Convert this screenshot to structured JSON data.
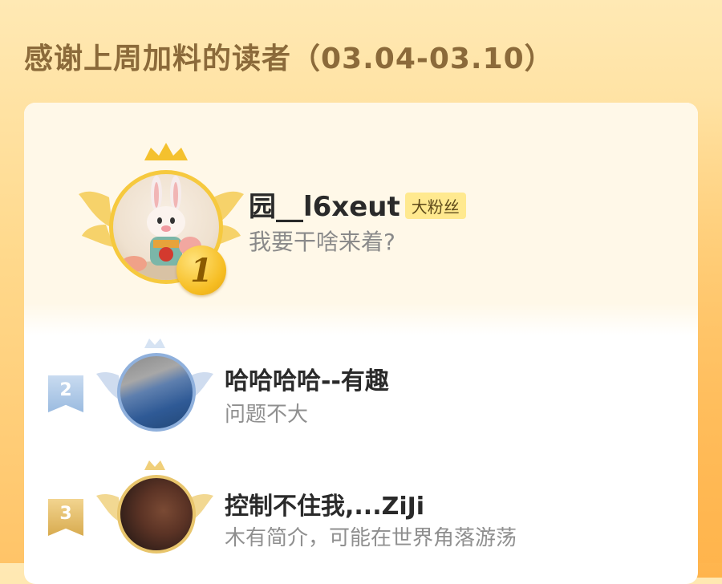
{
  "page": {
    "title": "感谢上周加料的读者（03.04-03.10）"
  },
  "ranking": [
    {
      "rank": "1",
      "name": "园__l6xeut",
      "badge": "大粉丝",
      "bio": "我要干啥来着?"
    },
    {
      "rank": "2",
      "name": "哈哈哈哈--有趣",
      "bio": "问题不大"
    },
    {
      "rank": "3",
      "name": "控制不住我,...ZiJi",
      "bio": "木有简介，可能在世界角落游荡"
    }
  ],
  "colors": {
    "gold": "#f6c93e",
    "silver": "#8fb0dc",
    "bronze": "#e8c56c",
    "title": "#8b6a3a"
  }
}
